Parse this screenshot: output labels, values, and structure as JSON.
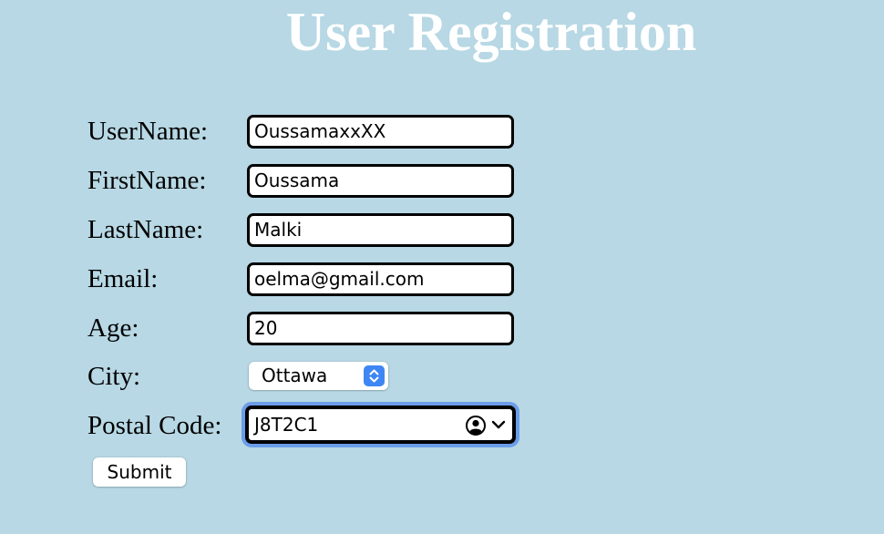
{
  "page": {
    "title": "User Registration"
  },
  "form": {
    "username": {
      "label": "UserName:",
      "value": "OussamaxxXX"
    },
    "firstname": {
      "label": "FirstName:",
      "value": "Oussama"
    },
    "lastname": {
      "label": "LastName:",
      "value": "Malki"
    },
    "email": {
      "label": "Email:",
      "value": "oelma@gmail.com"
    },
    "age": {
      "label": "Age:",
      "value": "20"
    },
    "city": {
      "label": "City:",
      "selected": "Ottawa"
    },
    "postal_code": {
      "label": "Postal Code:",
      "value": "J8T2C1",
      "autofill_icon": "contact-autofill-icon",
      "dropdown_icon": "chevron-down-icon"
    },
    "submit_label": "Submit"
  },
  "colors": {
    "background": "#b7d8e4",
    "title": "#ffffff",
    "focus_ring": "#6c9de9",
    "select_stepper": "#3d86f4"
  }
}
